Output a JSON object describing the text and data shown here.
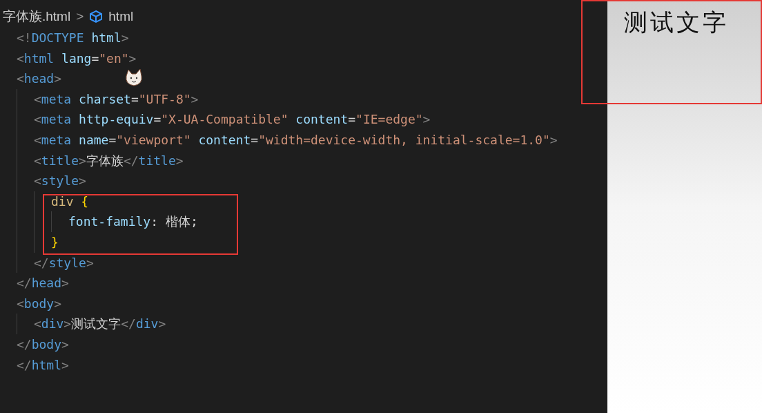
{
  "breadcrumb": {
    "file": "字体族.html",
    "separator": ">",
    "symbol": "html"
  },
  "code_lines": [
    {
      "tokens": [
        {
          "kind": "punct",
          "text": "<!"
        },
        {
          "kind": "tag",
          "text": "DOCTYPE"
        },
        {
          "kind": "attr",
          "text": " html"
        },
        {
          "kind": "punct",
          "text": ">"
        }
      ]
    },
    {
      "tokens": [
        {
          "kind": "punct",
          "text": "<"
        },
        {
          "kind": "tag",
          "text": "html"
        },
        {
          "kind": "attr",
          "text": " lang"
        },
        {
          "kind": "text",
          "text": "="
        },
        {
          "kind": "string",
          "text": "\"en\""
        },
        {
          "kind": "punct",
          "text": ">"
        }
      ]
    },
    {
      "tokens": [
        {
          "kind": "punct",
          "text": "<"
        },
        {
          "kind": "tag",
          "text": "head"
        },
        {
          "kind": "punct",
          "text": ">"
        }
      ],
      "children": [
        {
          "tokens": [
            {
              "kind": "punct",
              "text": "<"
            },
            {
              "kind": "tag",
              "text": "meta"
            },
            {
              "kind": "attr",
              "text": " charset"
            },
            {
              "kind": "text",
              "text": "="
            },
            {
              "kind": "string",
              "text": "\"UTF-8\""
            },
            {
              "kind": "punct",
              "text": ">"
            }
          ]
        },
        {
          "tokens": [
            {
              "kind": "punct",
              "text": "<"
            },
            {
              "kind": "tag",
              "text": "meta"
            },
            {
              "kind": "attr",
              "text": " http-equiv"
            },
            {
              "kind": "text",
              "text": "="
            },
            {
              "kind": "string",
              "text": "\"X-UA-Compatible\""
            },
            {
              "kind": "attr",
              "text": " content"
            },
            {
              "kind": "text",
              "text": "="
            },
            {
              "kind": "string",
              "text": "\"IE=edge\""
            },
            {
              "kind": "punct",
              "text": ">"
            }
          ]
        },
        {
          "tokens": [
            {
              "kind": "punct",
              "text": "<"
            },
            {
              "kind": "tag",
              "text": "meta"
            },
            {
              "kind": "attr",
              "text": " name"
            },
            {
              "kind": "text",
              "text": "="
            },
            {
              "kind": "string",
              "text": "\"viewport\""
            },
            {
              "kind": "attr",
              "text": " content"
            },
            {
              "kind": "text",
              "text": "="
            },
            {
              "kind": "string",
              "text": "\"width=device-width, initial-scale=1.0\""
            },
            {
              "kind": "punct",
              "text": ">"
            }
          ]
        },
        {
          "tokens": [
            {
              "kind": "punct",
              "text": "<"
            },
            {
              "kind": "tag",
              "text": "title"
            },
            {
              "kind": "punct",
              "text": ">"
            },
            {
              "kind": "text",
              "text": "字体族"
            },
            {
              "kind": "punct",
              "text": "</"
            },
            {
              "kind": "tag",
              "text": "title"
            },
            {
              "kind": "punct",
              "text": ">"
            }
          ]
        },
        {
          "tokens": [
            {
              "kind": "punct",
              "text": "<"
            },
            {
              "kind": "tag",
              "text": "style"
            },
            {
              "kind": "punct",
              "text": ">"
            }
          ],
          "children": [
            {
              "tokens": [
                {
                  "kind": "selector",
                  "text": "div"
                },
                {
                  "kind": "brace",
                  "text": " {"
                }
              ],
              "children": [
                {
                  "tokens": [
                    {
                      "kind": "attr",
                      "text": "font-family"
                    },
                    {
                      "kind": "text",
                      "text": ": 楷体;"
                    }
                  ]
                }
              ]
            },
            {
              "tokens": [
                {
                  "kind": "brace",
                  "text": "}"
                }
              ]
            }
          ]
        },
        {
          "tokens": [
            {
              "kind": "punct",
              "text": "</"
            },
            {
              "kind": "tag",
              "text": "style"
            },
            {
              "kind": "punct",
              "text": ">"
            }
          ]
        }
      ]
    },
    {
      "tokens": [
        {
          "kind": "punct",
          "text": "</"
        },
        {
          "kind": "tag",
          "text": "head"
        },
        {
          "kind": "punct",
          "text": ">"
        }
      ]
    },
    {
      "tokens": [
        {
          "kind": "punct",
          "text": "<"
        },
        {
          "kind": "tag",
          "text": "body"
        },
        {
          "kind": "punct",
          "text": ">"
        }
      ],
      "children": [
        {
          "tokens": [
            {
              "kind": "punct",
              "text": "<"
            },
            {
              "kind": "tag",
              "text": "div"
            },
            {
              "kind": "punct",
              "text": ">"
            },
            {
              "kind": "text",
              "text": "测试文字"
            },
            {
              "kind": "punct",
              "text": "</"
            },
            {
              "kind": "tag",
              "text": "div"
            },
            {
              "kind": "punct",
              "text": ">"
            }
          ]
        }
      ]
    },
    {
      "tokens": [
        {
          "kind": "punct",
          "text": "</"
        },
        {
          "kind": "tag",
          "text": "body"
        },
        {
          "kind": "punct",
          "text": ">"
        }
      ]
    },
    {
      "tokens": [
        {
          "kind": "punct",
          "text": "</"
        },
        {
          "kind": "tag",
          "text": "html"
        },
        {
          "kind": "punct",
          "text": ">"
        }
      ]
    }
  ],
  "preview": {
    "text": "测试文字"
  }
}
